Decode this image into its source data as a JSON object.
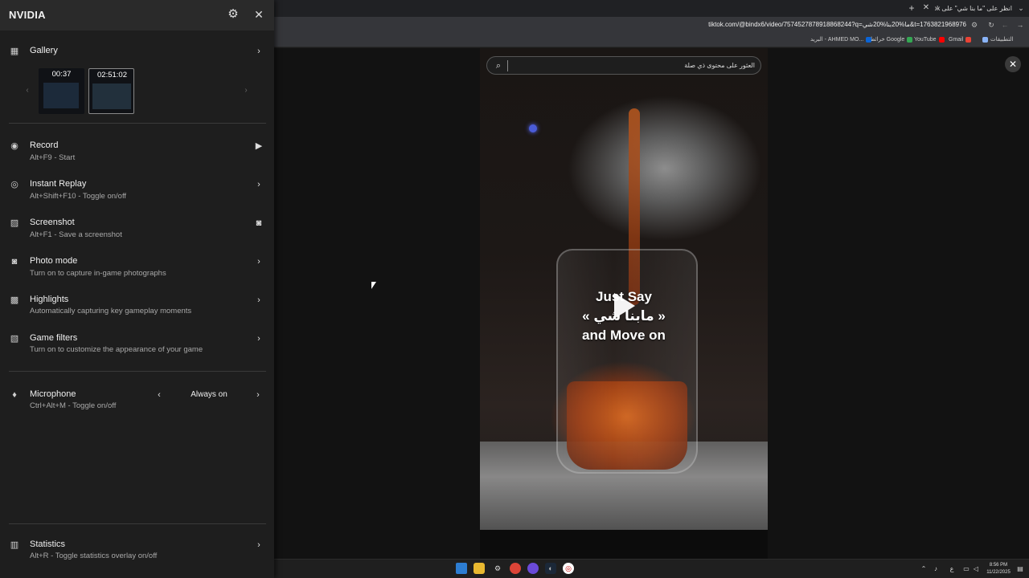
{
  "browser": {
    "tab_title": "انظر على \"ما بنا شي\" على TikTok",
    "new_tab_icon": "plus-icon",
    "url": "tiktok.com/@bindx6/video/7574527878918868244?q=ما%20بنا%20شي&t=1763821968976",
    "bookmarks": [
      {
        "label": "التطبيقات",
        "icon": "apps-grid-icon",
        "color": "#8ab4f8"
      },
      {
        "label": "Gmail",
        "icon": "gmail-icon",
        "color": "#ea4335"
      },
      {
        "label": "YouTube",
        "icon": "youtube-icon",
        "color": "#ff0000"
      },
      {
        "label": "خرائط Google",
        "icon": "maps-icon",
        "color": "#34a853"
      },
      {
        "label": "البريد - AHMED MO...",
        "icon": "outlook-icon",
        "color": "#0a64d6"
      }
    ]
  },
  "video": {
    "search_placeholder": "العثور على محتوى ذي صلة",
    "overlay_line1": "Just Say",
    "overlay_line2": "« مابنا شي »",
    "overlay_line3": "and Move on"
  },
  "nvidia": {
    "brand": "NVIDIA",
    "gallery": {
      "title": "Gallery",
      "thumbs": [
        {
          "duration": "00:37"
        },
        {
          "duration": "02:51:02"
        }
      ]
    },
    "items": [
      {
        "title": "Record",
        "subtitle": "Alt+F9 - Start",
        "icon": "record-icon",
        "action": "play-icon"
      },
      {
        "title": "Instant Replay",
        "subtitle": "Alt+Shift+F10 - Toggle on/off",
        "icon": "replay-icon",
        "action": "chevron-right-icon"
      },
      {
        "title": "Screenshot",
        "subtitle": "Alt+F1 - Save a screenshot",
        "icon": "image-icon",
        "action": "camera-icon"
      },
      {
        "title": "Photo mode",
        "subtitle": "Turn on to capture in-game photographs",
        "icon": "camera-icon",
        "action": "chevron-right-icon"
      },
      {
        "title": "Highlights",
        "subtitle": "Automatically capturing key gameplay moments",
        "icon": "clapper-icon",
        "action": "chevron-right-icon"
      },
      {
        "title": "Game filters",
        "subtitle": "Turn on to customize the appearance of your game",
        "icon": "filters-icon",
        "action": "chevron-right-icon"
      }
    ],
    "microphone": {
      "title": "Microphone",
      "subtitle": "Ctrl+Alt+M - Toggle on/off",
      "value": "Always on"
    },
    "statistics": {
      "title": "Statistics",
      "subtitle": "Alt+R - Toggle statistics overlay on/off"
    }
  },
  "taskbar": {
    "time": "8:56 PM",
    "date": "11/22/2025",
    "lang": "ع"
  }
}
